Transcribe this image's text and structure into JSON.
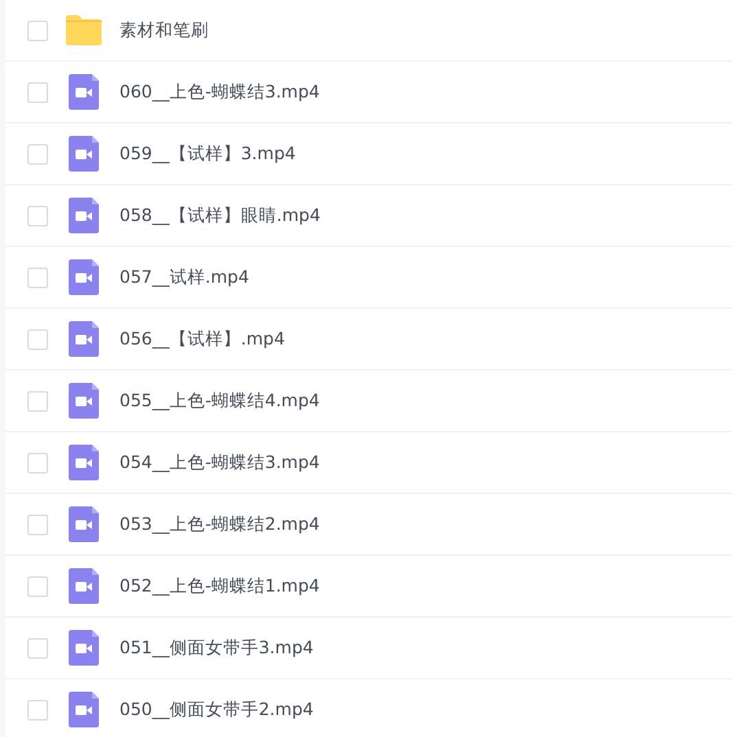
{
  "files": [
    {
      "kind": "folder",
      "name": "素材和笔刷",
      "checked": false
    },
    {
      "kind": "video",
      "name": "060__上色-蝴蝶结3.mp4",
      "checked": false
    },
    {
      "kind": "video",
      "name": "059__【试样】3.mp4",
      "checked": false
    },
    {
      "kind": "video",
      "name": "058__【试样】眼睛.mp4",
      "checked": false
    },
    {
      "kind": "video",
      "name": "057__试样.mp4",
      "checked": false
    },
    {
      "kind": "video",
      "name": "056__【试样】.mp4",
      "checked": false
    },
    {
      "kind": "video",
      "name": "055__上色-蝴蝶结4.mp4",
      "checked": false
    },
    {
      "kind": "video",
      "name": "054__上色-蝴蝶结3.mp4",
      "checked": false
    },
    {
      "kind": "video",
      "name": "053__上色-蝴蝶结2.mp4",
      "checked": false
    },
    {
      "kind": "video",
      "name": "052__上色-蝴蝶结1.mp4",
      "checked": false
    },
    {
      "kind": "video",
      "name": "051__侧面女带手3.mp4",
      "checked": false
    },
    {
      "kind": "video",
      "name": "050__侧面女带手2.mp4",
      "checked": false
    }
  ]
}
